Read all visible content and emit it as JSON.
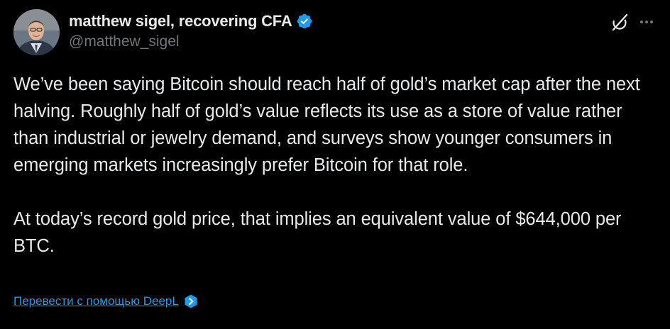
{
  "author": {
    "display_name": "matthew sigel, recovering CFA",
    "handle": "@matthew_sigel",
    "verified": true,
    "verified_color": "#1d9bf0"
  },
  "actions": {
    "icons": [
      "grok-icon",
      "more-icon"
    ]
  },
  "tweet": {
    "paragraphs": [
      "We’ve been saying Bitcoin should reach half of gold’s market cap after the next halving. Roughly half of gold’s value reflects its use as a store of value rather than industrial or jewelry demand, and surveys show younger consumers in emerging markets increasingly prefer Bitcoin for that role.",
      "At today’s record gold price, that implies an equivalent value of $644,000 per BTC."
    ]
  },
  "translate": {
    "label": "Перевести с помощью DeepL",
    "icon": "deepl-icon",
    "link_color": "#1d9bf0"
  },
  "theme": {
    "background": "#000000",
    "text": "#e7e9ea",
    "secondary_text": "#71767b",
    "accent": "#1d9bf0"
  }
}
